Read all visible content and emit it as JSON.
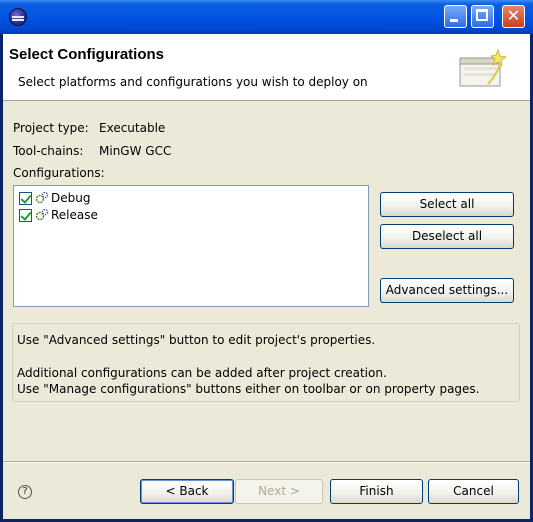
{
  "title_bar": {
    "icon": "eclipse-icon",
    "buttons": [
      "minimize-icon",
      "maximize-icon",
      "close-icon"
    ]
  },
  "header": {
    "title": "Select Configurations",
    "description": "Select platforms and configurations you wish to deploy on",
    "icon": "wizard-banner-icon"
  },
  "project": {
    "type_label": "Project type:",
    "type_value": "Executable",
    "toolchains_label": "Tool-chains:",
    "toolchains_value": "MinGW GCC",
    "configurations_label": "Configurations:"
  },
  "configurations": [
    {
      "label": "Debug",
      "checked": true,
      "icon": "configuration-icon"
    },
    {
      "label": "Release",
      "checked": true,
      "icon": "configuration-icon"
    }
  ],
  "side_buttons": {
    "select_all": "Select all",
    "deselect_all": "Deselect all",
    "advanced": "Advanced settings..."
  },
  "info": {
    "line1": "Use \"Advanced settings\" button to edit project's properties.",
    "line2": "Additional configurations can be added after project creation.",
    "line3": "Use \"Manage configurations\" buttons either on toolbar or on property pages."
  },
  "footer": {
    "help_icon": "help-icon",
    "back": "< Back",
    "next": "Next >",
    "finish": "Finish",
    "cancel": "Cancel"
  },
  "colors": {
    "titlebar": "#0055e5",
    "dialog_bg": "#ece9d8",
    "checkmark": "#21a121"
  }
}
